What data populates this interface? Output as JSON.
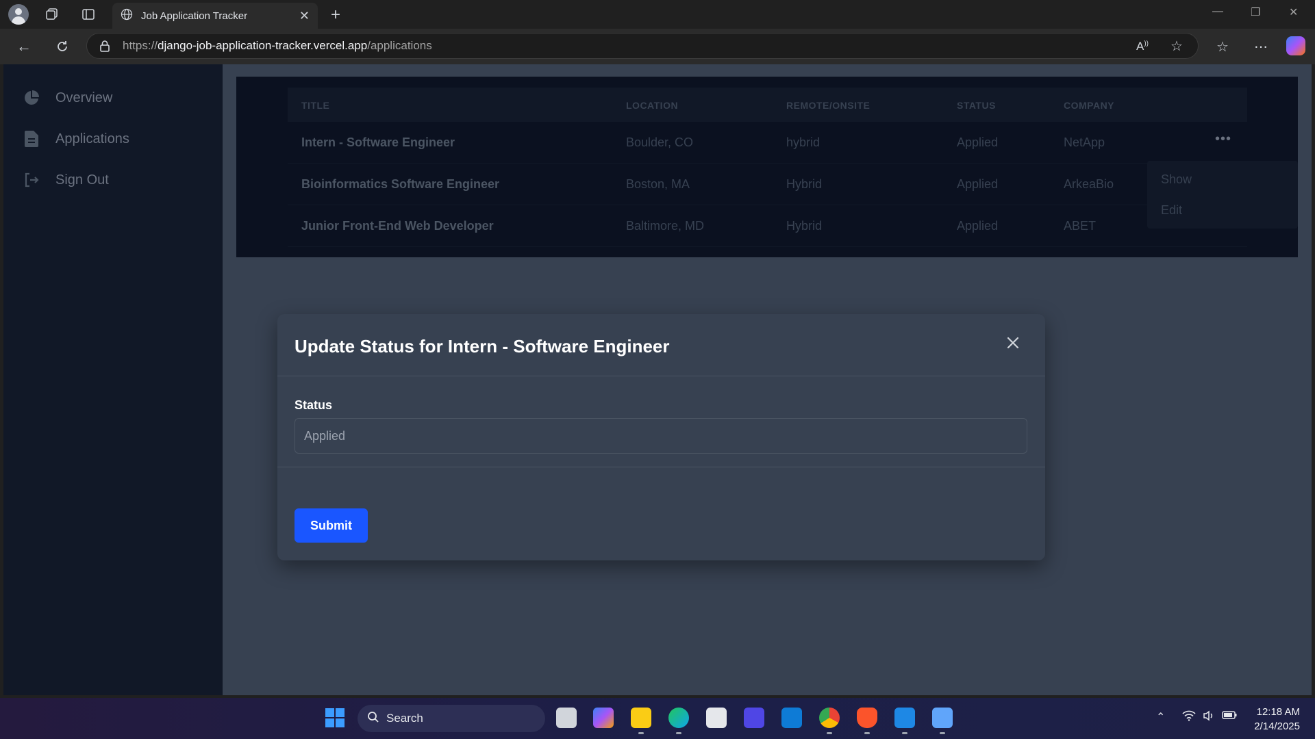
{
  "browser": {
    "tab_title": "Job Application Tracker",
    "url_prefix": "https://",
    "url_host": "django-job-application-tracker.vercel.app",
    "url_path": "/applications"
  },
  "sidebar": {
    "items": [
      {
        "label": "Overview",
        "icon": "chart-pie-icon"
      },
      {
        "label": "Applications",
        "icon": "document-icon"
      },
      {
        "label": "Sign Out",
        "icon": "sign-out-icon"
      }
    ]
  },
  "table": {
    "headers": [
      "TITLE",
      "LOCATION",
      "REMOTE/ONSITE",
      "STATUS",
      "COMPANY"
    ],
    "rows": [
      {
        "title": "Intern - Software Engineer",
        "location": "Boulder, CO",
        "remote": "hybrid",
        "status": "Applied",
        "company": "NetApp"
      },
      {
        "title": "Bioinformatics Software Engineer",
        "location": "Boston, MA",
        "remote": "Hybrid",
        "status": "Applied",
        "company": "ArkeaBio"
      },
      {
        "title": "Junior Front-End Web Developer",
        "location": "Baltimore, MD",
        "remote": "Hybrid",
        "status": "Applied",
        "company": "ABET"
      }
    ],
    "row_menu": {
      "dots": "•••",
      "show": "Show",
      "edit": "Edit"
    }
  },
  "modal": {
    "title": "Update Status for Intern - Software Engineer",
    "field_label": "Status",
    "field_value": "Applied",
    "submit_label": "Submit"
  },
  "taskbar": {
    "search_label": "Search",
    "time": "12:18 AM",
    "date": "2/14/2025"
  },
  "colors": {
    "accent": "#1a56ff",
    "sidebar": "#111827",
    "page_bg": "#374151"
  }
}
